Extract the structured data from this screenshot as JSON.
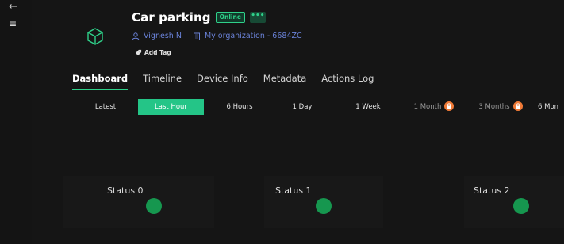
{
  "nav": {
    "back_icon": "arrow-left-icon",
    "menu_icon": "hamburger-menu-icon"
  },
  "device": {
    "icon": "cube-icon",
    "name": "Car parking",
    "status": "Online",
    "more_label": "•••",
    "owner": "Vignesh N",
    "organization": "My organization - 6684ZC",
    "add_tag_label": "Add Tag"
  },
  "tabs": [
    {
      "label": "Dashboard",
      "active": true
    },
    {
      "label": "Timeline"
    },
    {
      "label": "Device Info"
    },
    {
      "label": "Metadata"
    },
    {
      "label": "Actions Log"
    }
  ],
  "time_ranges": [
    {
      "label": "Latest"
    },
    {
      "label": "Last Hour",
      "active": true
    },
    {
      "label": "6 Hours"
    },
    {
      "label": "1 Day"
    },
    {
      "label": "1 Week"
    },
    {
      "label": "1 Month",
      "locked": true
    },
    {
      "label": "3 Months",
      "locked": true
    },
    {
      "label": "6 Mon"
    }
  ],
  "widgets": [
    {
      "label": "Status 0",
      "indicator": "green"
    },
    {
      "label": "Status 1",
      "indicator": "green"
    },
    {
      "label": "Status 2",
      "indicator": "green"
    }
  ],
  "colors": {
    "accent": "#2fd18a",
    "active_range": "#24c587",
    "link": "#6a82d8",
    "lock_badge": "#f07a37",
    "status_indicator": "#16974f",
    "background": "#151515"
  }
}
